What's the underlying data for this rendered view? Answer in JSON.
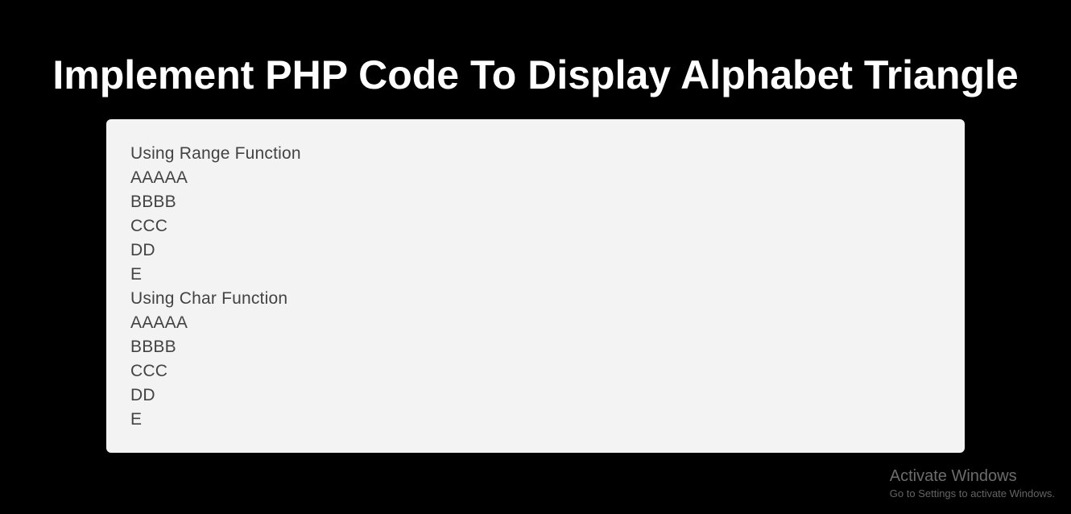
{
  "title": "Implement PHP Code To Display Alphabet Triangle",
  "output": {
    "lines": [
      "Using Range Function",
      "AAAAA",
      "BBBB",
      "CCC",
      "DD",
      "E",
      "Using Char Function",
      "AAAAA",
      "BBBB",
      "CCC",
      "DD",
      "E"
    ]
  },
  "watermark": {
    "title": "Activate Windows",
    "subtitle": "Go to Settings to activate Windows."
  }
}
